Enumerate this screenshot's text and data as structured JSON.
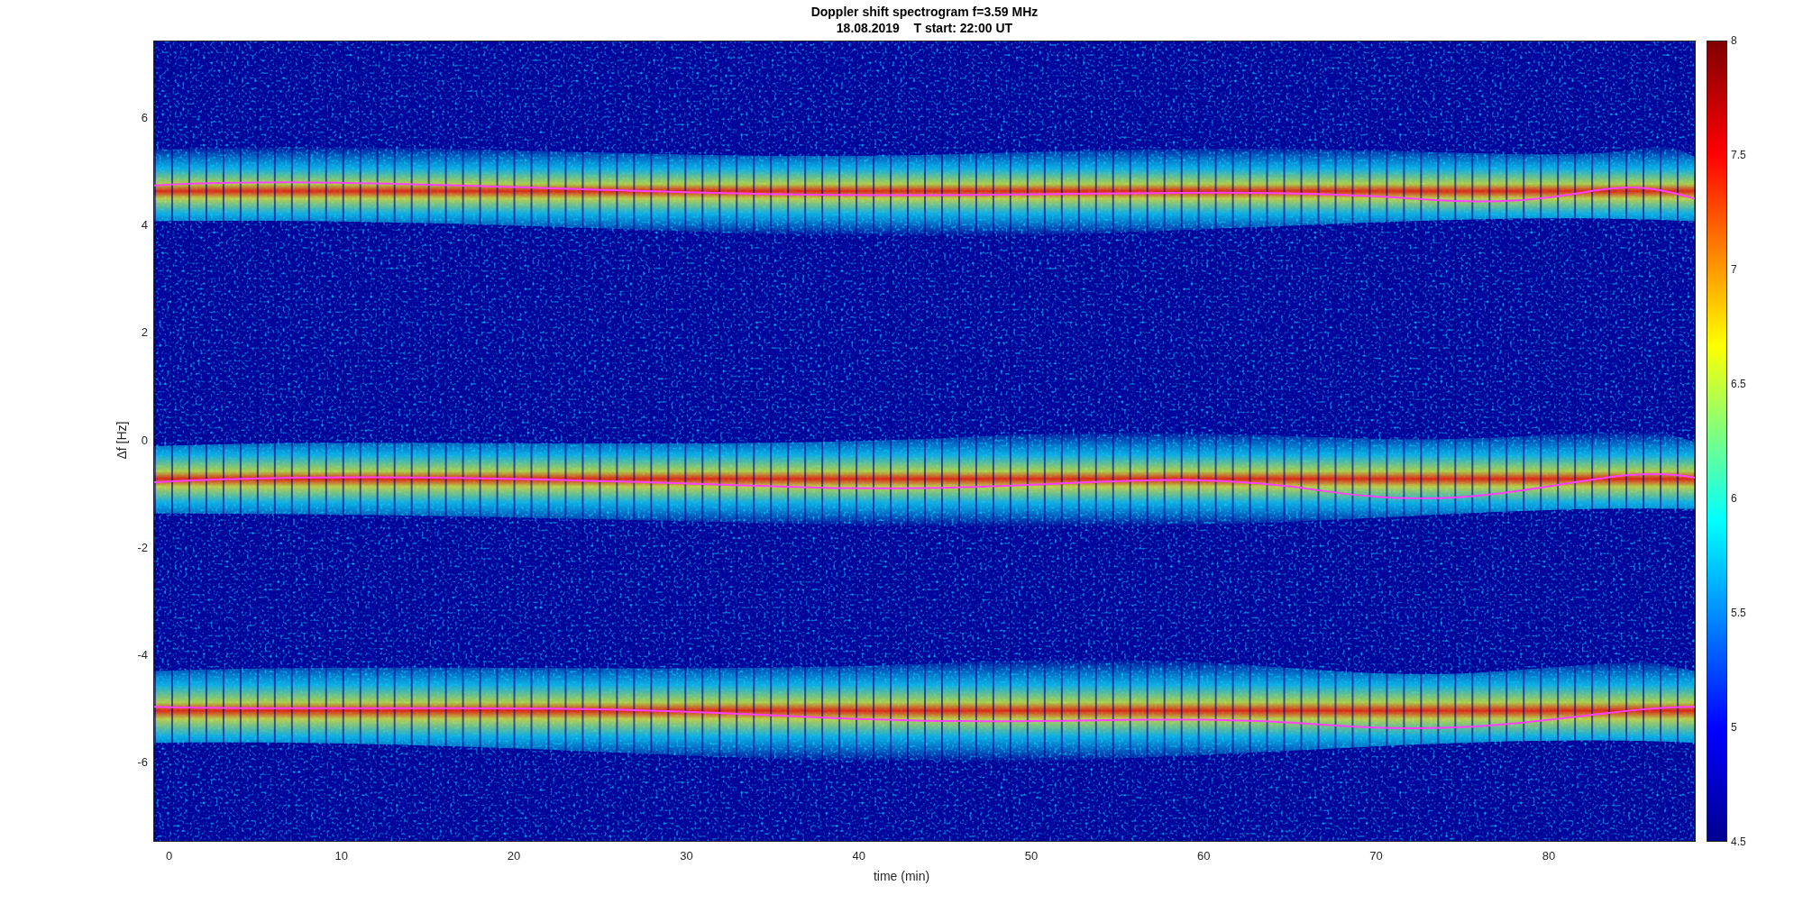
{
  "title": "Doppler shift spectrogram f=3.59 MHz",
  "subtitle": "18.08.2019    T start: 22:00 UT",
  "xlabel": "time (min)",
  "ylabel": "Δf [Hz]",
  "xticks": [
    "0",
    "10",
    "20",
    "30",
    "40",
    "50",
    "60",
    "70",
    "80"
  ],
  "yticks": [
    "6",
    "4",
    "2",
    "0",
    "-2",
    "-4",
    "-6"
  ],
  "colorbar_ticks": [
    "8",
    "7.5",
    "7",
    "6.5",
    "6",
    "5.5",
    "5",
    "4.5"
  ]
}
